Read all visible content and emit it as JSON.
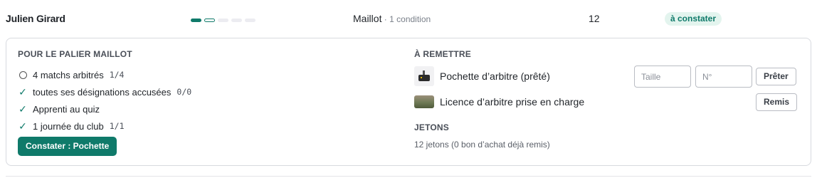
{
  "row": {
    "name": "Julien Girard",
    "progress": [
      "done",
      "partial",
      "empty",
      "empty",
      "empty"
    ],
    "level": "Maillot",
    "level_sep": " · ",
    "conditions_count": "1 condition",
    "count": "12",
    "status": "à constater"
  },
  "panel": {
    "conditions_title": "POUR LE PALIER MAILLOT",
    "conditions": [
      {
        "state": "pending",
        "label": "4 matchs arbitrés",
        "fraction": "1/4"
      },
      {
        "state": "done",
        "label": "toutes ses désignations accusées",
        "fraction": "0/0"
      },
      {
        "state": "done",
        "label": "Apprenti au quiz",
        "fraction": ""
      },
      {
        "state": "done",
        "label": "1 journée du club",
        "fraction": "1/1"
      }
    ],
    "confirm_button": "Constater : Pochette",
    "handover_title": "À REMETTRE",
    "items": [
      {
        "label": "Pochette d’arbitre (prêté)",
        "thumb": "pouch-icon",
        "size_placeholder": "Taille",
        "number_placeholder": "N°",
        "button": "Prêter"
      },
      {
        "label": "Licence d’arbitre prise en charge",
        "thumb": "license-image",
        "button": "Remis"
      }
    ],
    "tokens_title": "JETONS",
    "tokens_text": "12 jetons (0 bon d’achat déjà remis)"
  },
  "colors": {
    "accent": "#0f7a6a",
    "badge_bg": "#e3f4ee",
    "border": "#d8dadf"
  }
}
